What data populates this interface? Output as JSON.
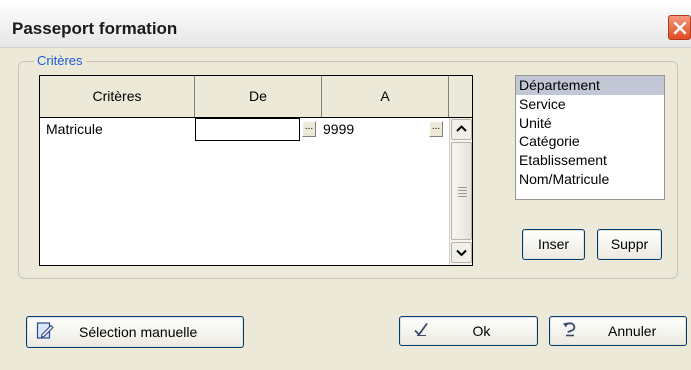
{
  "window": {
    "title": "Passeport formation"
  },
  "group": {
    "legend": "Critères"
  },
  "grid": {
    "headers": [
      "Critères",
      "De",
      "A"
    ],
    "rows": [
      {
        "critere": "Matricule",
        "de": "",
        "a": "9999"
      }
    ],
    "ellipsis": "..."
  },
  "criteria_list": {
    "items": [
      "Département",
      "Service",
      "Unité",
      "Catégorie",
      "Etablissement",
      "Nom/Matricule"
    ],
    "selected": "Département"
  },
  "buttons": {
    "inser": "Inser",
    "suppr": "Suppr",
    "manual_selection": "Sélection manuelle",
    "ok": "Ok",
    "cancel": "Annuler"
  },
  "icons": {
    "close": "close-icon",
    "manual_selection": "document-edit-icon",
    "ok": "checkmark-icon",
    "cancel": "undo-arrow-icon"
  },
  "colors": {
    "legend": "#1c5bd6",
    "selection": "#c2c7d6",
    "close_button": "#e04a22"
  }
}
